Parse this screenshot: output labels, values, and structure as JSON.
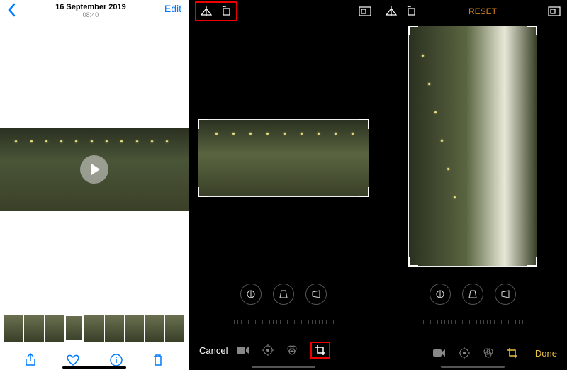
{
  "screen1": {
    "date": "16 September 2019",
    "time": "08:40",
    "edit_label": "Edit"
  },
  "screen2": {
    "cancel_label": "Cancel",
    "flip_icon": "flip-horizontal",
    "rotate_icon": "rotate",
    "aspect_icon": "aspect-ratio"
  },
  "screen3": {
    "reset_label": "RESET",
    "done_label": "Done"
  },
  "adjust_buttons": {
    "straighten": "straighten",
    "vertical": "vertical-perspective",
    "horizontal": "horizontal-perspective"
  },
  "tools": {
    "video": "video",
    "adjust": "adjust",
    "filters": "filters",
    "crop": "crop"
  }
}
